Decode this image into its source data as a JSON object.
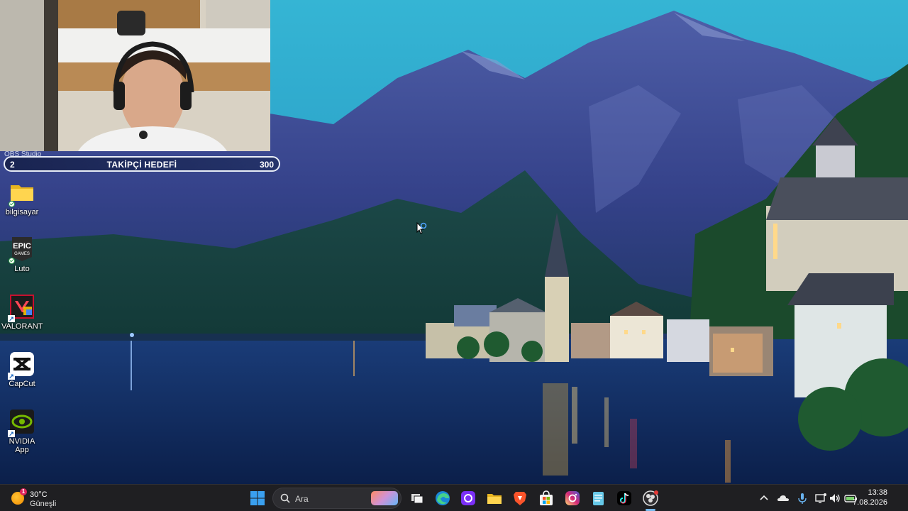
{
  "webcam_overlay": {
    "source_label": "OBS Studio",
    "follower_goal": {
      "current": "2",
      "title": "TAKİPÇİ HEDEFİ",
      "target": "300"
    }
  },
  "desktop": {
    "icons": [
      {
        "label": "bilgisayar",
        "icon": "folder-icon"
      },
      {
        "label": "Luto",
        "icon": "epic-games-icon",
        "logo_text": "EPIC\nGAMES"
      },
      {
        "label": "VALORANT",
        "icon": "valorant-icon"
      },
      {
        "label": "CapCut",
        "icon": "capcut-icon"
      },
      {
        "label": "NVIDIA App",
        "icon": "nvidia-icon"
      }
    ]
  },
  "taskbar": {
    "weather": {
      "temperature": "30°C",
      "description": "Güneşli",
      "alert_count": "1"
    },
    "search": {
      "placeholder": "Ara"
    },
    "apps": [
      "start-icon",
      "task-view-icon",
      "edge-icon",
      "photo-app-icon",
      "file-explorer-icon",
      "brave-icon",
      "microsoft-store-icon",
      "instagram-icon",
      "notepad-icon",
      "tiktok-icon",
      "obs-icon"
    ],
    "tray": [
      "chevron-up-icon",
      "onedrive-icon",
      "microphone-icon",
      "network-icon",
      "volume-icon",
      "battery-icon"
    ],
    "clock": {
      "time": "13:38",
      "date": "7.08.2026"
    }
  },
  "colors": {
    "taskbar_bg": "#1f1f22",
    "sky": "#2aa6c9",
    "lake": "#0f2a5c",
    "accent": "#76b9ed"
  }
}
